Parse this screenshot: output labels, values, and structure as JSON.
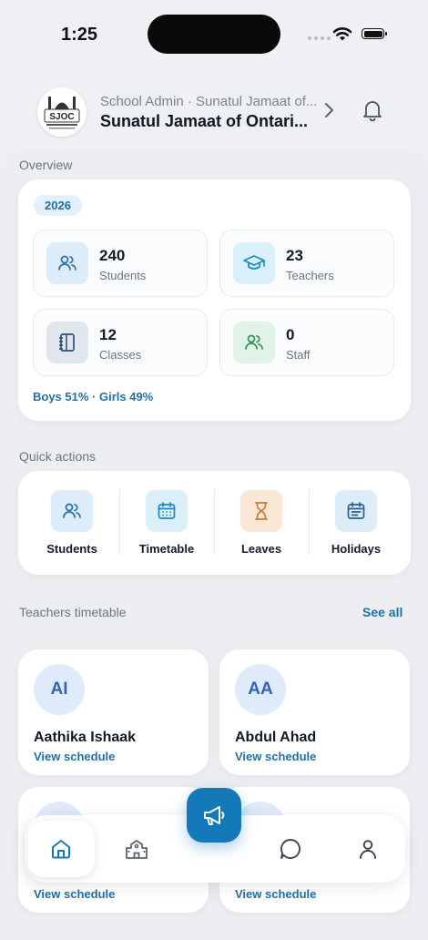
{
  "status_bar": {
    "time": "1:25"
  },
  "header": {
    "subtitle": "School Admin · Sunatul Jamaat of...",
    "title": "Sunatul Jamaat of Ontari...",
    "logo_text": "SJOC"
  },
  "overview": {
    "label": "Overview",
    "year": "2026",
    "stats": [
      {
        "value": "240",
        "label": "Students",
        "icon": "students-icon"
      },
      {
        "value": "23",
        "label": "Teachers",
        "icon": "graduation-cap-icon"
      },
      {
        "value": "12",
        "label": "Classes",
        "icon": "notebook-icon"
      },
      {
        "value": "0",
        "label": "Staff",
        "icon": "staff-icon"
      }
    ],
    "ratio": "Boys 51% · Girls 49%"
  },
  "quick_actions": {
    "label": "Quick actions",
    "items": [
      {
        "label": "Students",
        "icon": "students-icon"
      },
      {
        "label": "Timetable",
        "icon": "calendar-icon"
      },
      {
        "label": "Leaves",
        "icon": "hourglass-icon"
      },
      {
        "label": "Holidays",
        "icon": "calendar-list-icon"
      }
    ]
  },
  "teachers_timetable": {
    "label": "Teachers timetable",
    "see_all": "See all",
    "teachers": [
      {
        "initials": "AI",
        "name": "Aathika Ishaak",
        "link": "View schedule"
      },
      {
        "initials": "AA",
        "name": "Abdul Ahad",
        "link": "View schedule"
      },
      {
        "initials": "",
        "name": "",
        "link": "View schedule"
      },
      {
        "initials": "",
        "name": "",
        "link": "View schedule"
      }
    ]
  },
  "bottom_nav": {
    "items": [
      "home-icon",
      "school-icon",
      "announcement-icon",
      "chat-icon",
      "profile-icon"
    ],
    "active": "home-icon"
  },
  "colors": {
    "accent": "#1479b8",
    "link": "#1f6fa8",
    "background": "#eef0f3"
  }
}
